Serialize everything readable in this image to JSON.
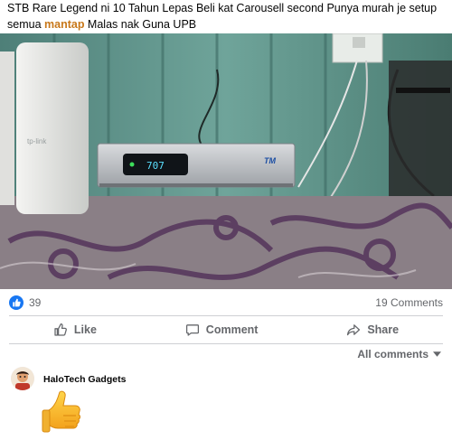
{
  "post": {
    "caption_part1": "STB Rare Legend ni 10 Tahun Lepas Beli kat Carousell second Punya murah je setup semua ",
    "caption_highlight": "mantap",
    "caption_part2": " Malas nak Guna UPB"
  },
  "photo": {
    "router_brand": "tp-link",
    "stb_display": "707",
    "stb_brand": "TM"
  },
  "stats": {
    "reaction_count": "39",
    "comments_count": "19 Comments"
  },
  "actions": {
    "like_label": "Like",
    "comment_label": "Comment",
    "share_label": "Share"
  },
  "filter": {
    "all_comments_label": "All comments"
  },
  "comment": {
    "author": "HaloTech Gadgets"
  },
  "icons": {
    "reaction": "like-reaction-icon",
    "like": "thumbs-up-icon",
    "comment": "speech-bubble-icon",
    "share": "share-arrow-icon",
    "dropdown": "caret-down-icon",
    "sticker": "thumbs-up-emoji-icon"
  },
  "colors": {
    "accent": "#1877f2",
    "highlight": "#c8781a",
    "secondary_text": "#65676b"
  }
}
